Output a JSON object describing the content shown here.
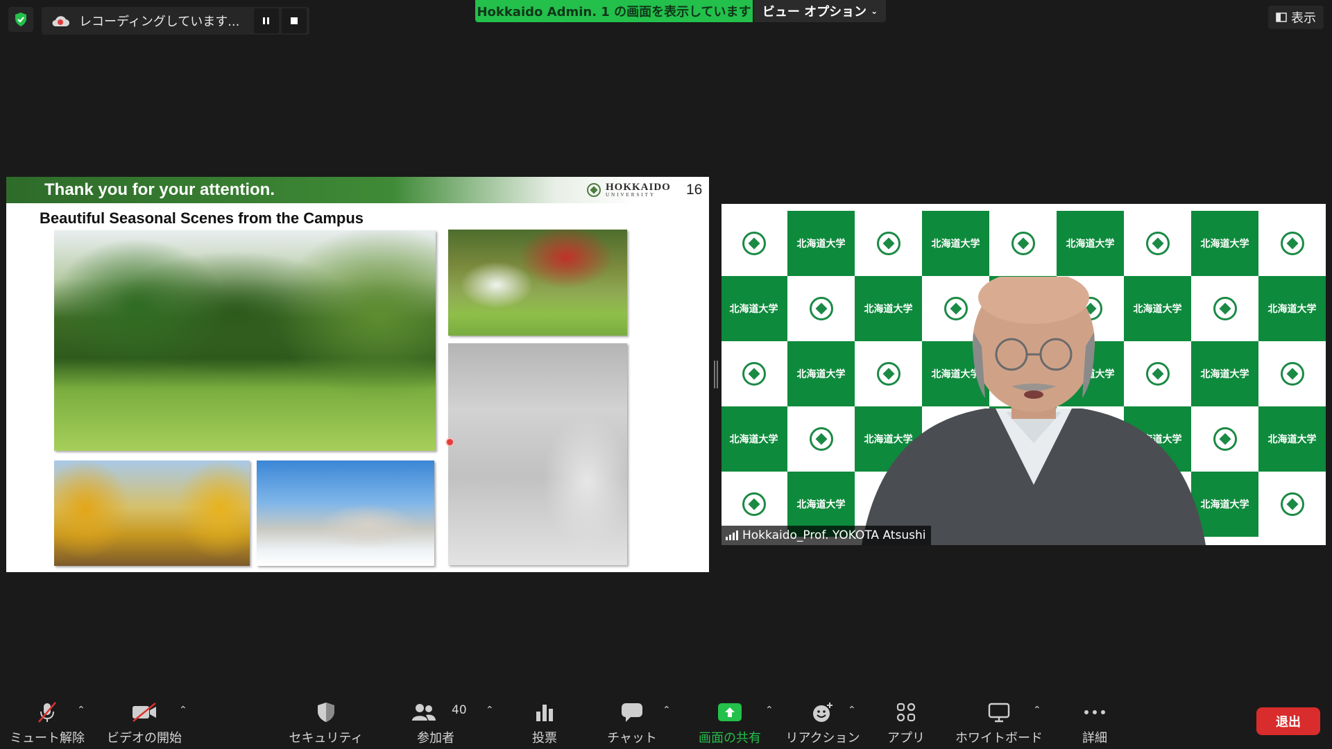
{
  "top": {
    "recording_status": "レコーディングしています...",
    "share_banner": "Hokkaido Admin. 1 の画面を表示しています",
    "view_options": "ビュー オプション",
    "show_button": "表示"
  },
  "slide": {
    "title": "Thank you for your attention.",
    "logo_main": "HOKKAIDO",
    "logo_sub": "UNIVERSITY",
    "page_number": "16",
    "subtitle": "Beautiful Seasonal Scenes from the Campus"
  },
  "video": {
    "participant_name": "Hokkaido_Prof. YOKOTA Atsushi",
    "backdrop_text": "北海道大学"
  },
  "toolbar": {
    "mute": "ミュート解除",
    "video": "ビデオの開始",
    "security": "セキュリティ",
    "participants": "参加者",
    "participant_count": "40",
    "polls": "投票",
    "chat": "チャット",
    "share": "画面の共有",
    "reactions": "リアクション",
    "apps": "アプリ",
    "whiteboard": "ホワイトボード",
    "more": "詳細",
    "leave": "退出"
  },
  "colors": {
    "share_green": "#23c04b",
    "leave_red": "#d92c2c",
    "backdrop_green": "#0e8a3c"
  }
}
